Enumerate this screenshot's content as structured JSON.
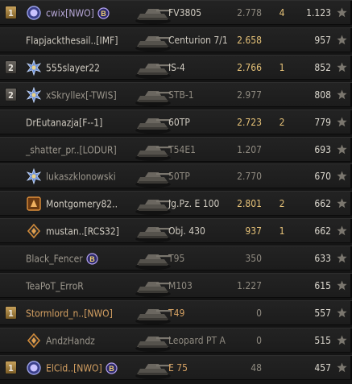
{
  "colors": {
    "row_bg": "#1e1e1e",
    "text": "#cfcac0",
    "orange": "#d4a062",
    "gold": "#e6c278",
    "dim": "#8f8a80"
  },
  "rows": [
    {
      "platoon": "1",
      "platoon_style": "gold",
      "badge": "medal-icon",
      "name": "cwix[NWO]",
      "name_style": "purple",
      "clan_badge": true,
      "tank": "FV3805",
      "tank_style": "normal",
      "eff": "2.778",
      "eff_style": "dim",
      "kills": "4",
      "xp": "1.123"
    },
    {
      "platoon": "",
      "platoon_style": "",
      "badge": "",
      "name": "Flapjackthesail..[IMF]",
      "name_style": "normal",
      "clan_badge": false,
      "tank": "Centurion 7/1",
      "tank_style": "normal",
      "eff": "2.658",
      "eff_style": "bright",
      "kills": "",
      "xp": "957"
    },
    {
      "platoon": "2",
      "platoon_style": "grey",
      "badge": "star-rank-icon",
      "name": "555slayer22",
      "name_style": "normal",
      "clan_badge": false,
      "tank": "IS-4",
      "tank_style": "normal",
      "eff": "2.766",
      "eff_style": "bright",
      "kills": "1",
      "xp": "852"
    },
    {
      "platoon": "2",
      "platoon_style": "grey",
      "badge": "star-rank-icon",
      "name": "xSkryllex[-TWIS]",
      "name_style": "dim",
      "clan_badge": false,
      "tank": "STB-1",
      "tank_style": "dim",
      "eff": "2.977",
      "eff_style": "dim",
      "kills": "",
      "xp": "808"
    },
    {
      "platoon": "",
      "platoon_style": "",
      "badge": "",
      "name": "DrEutanazja[F--1]",
      "name_style": "normal",
      "clan_badge": false,
      "tank": "60TP",
      "tank_style": "normal",
      "eff": "2.723",
      "eff_style": "bright",
      "kills": "2",
      "xp": "779"
    },
    {
      "platoon": "",
      "platoon_style": "",
      "badge": "",
      "name": "_shatter_pr..[LODUR]",
      "name_style": "dim",
      "clan_badge": false,
      "tank": "T54E1",
      "tank_style": "dim",
      "eff": "1.207",
      "eff_style": "dim",
      "kills": "",
      "xp": "693"
    },
    {
      "platoon": "",
      "platoon_style": "",
      "badge": "star-rank-icon",
      "name": "lukaszklonowski",
      "name_style": "dim",
      "clan_badge": false,
      "tank": "50TP",
      "tank_style": "dim",
      "eff": "2.770",
      "eff_style": "dim",
      "kills": "",
      "xp": "670"
    },
    {
      "platoon": "",
      "platoon_style": "",
      "badge": "orange-emblem-icon",
      "name": "Montgomery82..",
      "name_style": "normal",
      "clan_badge": false,
      "tank": "Jg.Pz. E 100",
      "tank_style": "normal",
      "eff": "2.801",
      "eff_style": "bright",
      "kills": "2",
      "xp": "662"
    },
    {
      "platoon": "",
      "platoon_style": "",
      "badge": "diamond-rank-icon",
      "name": "mustan..[RCS32]",
      "name_style": "normal",
      "clan_badge": false,
      "tank": "Obj. 430",
      "tank_style": "normal",
      "eff": "937",
      "eff_style": "bright",
      "kills": "1",
      "xp": "662"
    },
    {
      "platoon": "",
      "platoon_style": "",
      "badge": "",
      "name": "Black_Fencer",
      "name_style": "dim",
      "clan_badge": true,
      "tank": "T95",
      "tank_style": "dim",
      "eff": "350",
      "eff_style": "dim",
      "kills": "",
      "xp": "633"
    },
    {
      "platoon": "",
      "platoon_style": "",
      "badge": "",
      "name": "TeaPoT_ErroR",
      "name_style": "dim",
      "clan_badge": false,
      "tank": "M103",
      "tank_style": "dim",
      "eff": "1.227",
      "eff_style": "dim",
      "kills": "",
      "xp": "615"
    },
    {
      "platoon": "1",
      "platoon_style": "gold",
      "badge": "",
      "name": "Stormlord_n..[NWO]",
      "name_style": "orange",
      "clan_badge": false,
      "tank": "T49",
      "tank_style": "orange",
      "eff": "0",
      "eff_style": "dim",
      "kills": "",
      "xp": "557"
    },
    {
      "platoon": "",
      "platoon_style": "",
      "badge": "diamond-rank-icon",
      "name": "AndzHandz",
      "name_style": "dim",
      "clan_badge": false,
      "tank": "Leopard PT A",
      "tank_style": "dim",
      "eff": "0",
      "eff_style": "dim",
      "kills": "",
      "xp": "515"
    },
    {
      "platoon": "1",
      "platoon_style": "gold",
      "badge": "medal-icon",
      "name": "ElCid..[NWO]",
      "name_style": "orange",
      "clan_badge": true,
      "tank": "E 75",
      "tank_style": "orange",
      "eff": "48",
      "eff_style": "dim",
      "kills": "",
      "xp": "457"
    }
  ]
}
